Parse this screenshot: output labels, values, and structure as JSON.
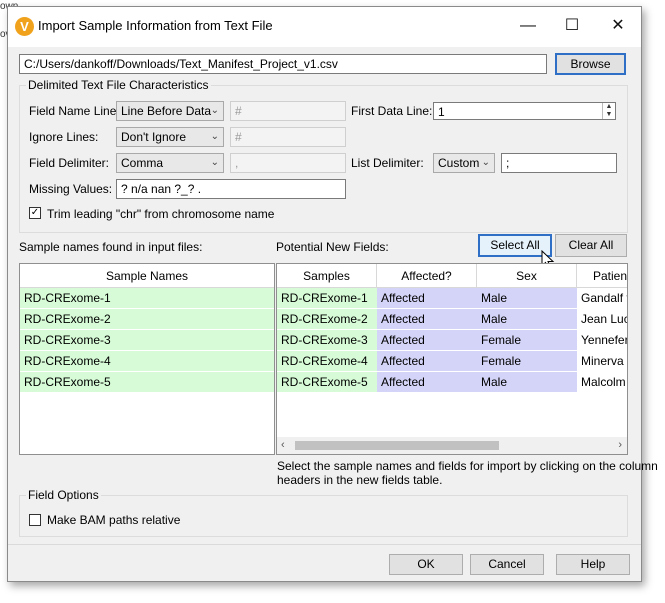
{
  "background_fragments": [
    "own",
    "",
    "ov"
  ],
  "window": {
    "title": "Import Sample Information from Text File",
    "minimize": "—",
    "maximize": "☐",
    "close": "✕",
    "app_icon_letter": "V"
  },
  "file": {
    "path": "C:/Users/dankoff/Downloads/Text_Manifest_Project_v1.csv",
    "browse_label": "Browse"
  },
  "characteristics": {
    "legend": "Delimited Text File Characteristics",
    "field_name_line": {
      "label": "Field Name Line:",
      "value": "Line Before Data",
      "hash": "#"
    },
    "ignore_lines": {
      "label": "Ignore Lines:",
      "value": "Don't Ignore",
      "hash": "#"
    },
    "field_delimiter": {
      "label": "Field Delimiter:",
      "value": "Comma",
      "char": ","
    },
    "missing_values": {
      "label": "Missing Values:",
      "value": "? n/a nan ?_? ."
    },
    "first_data_line": {
      "label": "First Data Line:",
      "value": "1"
    },
    "list_delimiter": {
      "label": "List Delimiter:",
      "value": "Custom",
      "char": ";"
    },
    "trim_chr": {
      "label": "Trim leading \"chr\" from chromosome name",
      "checked": true
    }
  },
  "samples": {
    "heading": "Sample names found in input files:",
    "column": "Sample Names",
    "rows": [
      "RD-CRExome-1",
      "RD-CRExome-2",
      "RD-CRExome-3",
      "RD-CRExome-4",
      "RD-CRExome-5"
    ]
  },
  "fields": {
    "heading": "Potential New Fields:",
    "select_all": "Select All",
    "clear_all": "Clear All",
    "columns": [
      "Samples",
      "Affected?",
      "Sex",
      "Patient"
    ],
    "rows": [
      [
        "RD-CRExome-1",
        "Affected",
        "Male",
        "Gandalf t"
      ],
      [
        "RD-CRExome-2",
        "Affected",
        "Male",
        "Jean Luc"
      ],
      [
        "RD-CRExome-3",
        "Affected",
        "Female",
        "Yennefer"
      ],
      [
        "RD-CRExome-4",
        "Affected",
        "Female",
        "Minerva"
      ],
      [
        "RD-CRExome-5",
        "Affected",
        "Male",
        "Malcolm"
      ]
    ],
    "help_text_1": "Select the sample names and fields for import by clicking on the column",
    "help_text_2": "headers in the new fields table."
  },
  "field_options": {
    "legend": "Field Options",
    "bam_relative": {
      "label": "Make BAM paths relative",
      "checked": false
    }
  },
  "footer": {
    "ok": "OK",
    "cancel": "Cancel",
    "help": "Help"
  },
  "colors": {
    "sample_green": "#d6fbd6",
    "selected_blue": "#d4d4f8",
    "focus_border": "#2f6fc5"
  }
}
